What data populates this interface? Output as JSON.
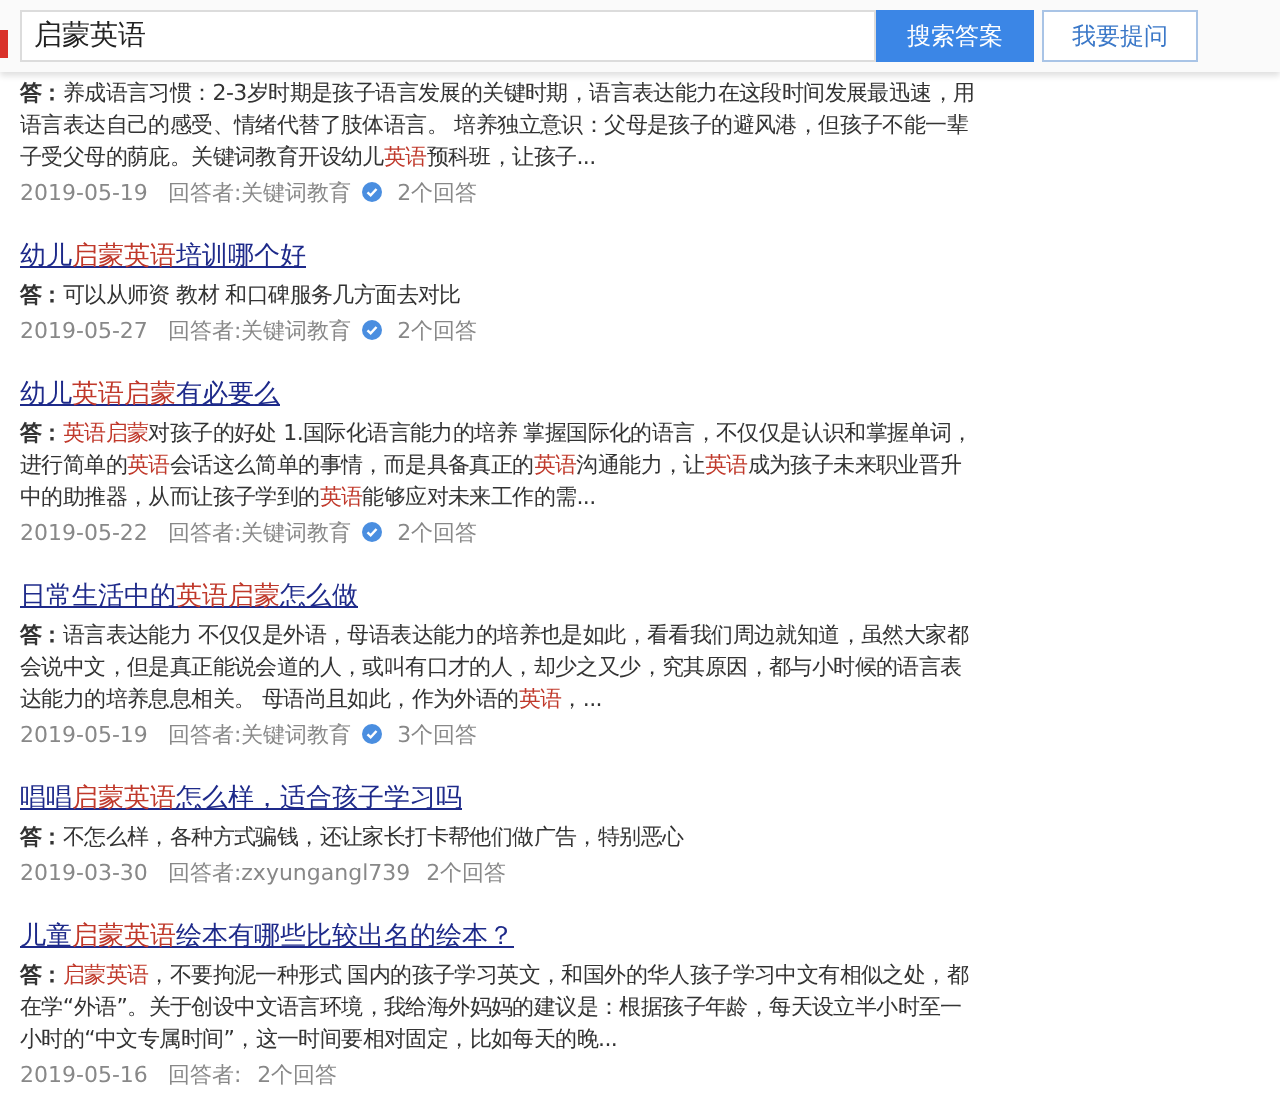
{
  "search": {
    "value": "启蒙英语",
    "submit": "搜索答案",
    "ask": "我要提问"
  },
  "results": [
    {
      "label": "答：",
      "answer": [
        {
          "text": "养成语言习惯：2-3岁时期是孩子语言发展的关键时期，语言表达能力在这段时间发展最迅速，用语言表达自己的感受、情绪代替了肢体语言。 培养独立意识：父母是孩子的避风港，但孩子不能一辈子受父母的荫庇。关键词教育开设幼儿",
          "highlight": false
        },
        {
          "text": "英语",
          "highlight": true
        },
        {
          "text": "预科班，让孩子...",
          "highlight": false
        }
      ],
      "date": "2019-05-19",
      "answerer_label": "回答者:",
      "answerer": "关键词教育",
      "verified": true,
      "count": "2个回答"
    },
    {
      "title": [
        {
          "text": "幼儿",
          "highlight": false
        },
        {
          "text": "启蒙英语",
          "highlight": true
        },
        {
          "text": "培训哪个好",
          "highlight": false
        }
      ],
      "label": "答：",
      "answer": [
        {
          "text": "可以从师资 教材 和口碑服务几方面去对比",
          "highlight": false
        }
      ],
      "date": "2019-05-27",
      "answerer_label": "回答者:",
      "answerer": "关键词教育",
      "verified": true,
      "count": "2个回答"
    },
    {
      "title": [
        {
          "text": "幼儿",
          "highlight": false
        },
        {
          "text": "英语启蒙",
          "highlight": true
        },
        {
          "text": "有必要么",
          "highlight": false
        }
      ],
      "label": "答：",
      "answer": [
        {
          "text": "英语启蒙",
          "highlight": true
        },
        {
          "text": "对孩子的好处 1.国际化语言能力的培养 掌握国际化的语言，不仅仅是认识和掌握单词，进行简单的",
          "highlight": false
        },
        {
          "text": "英语",
          "highlight": true
        },
        {
          "text": "会话这么简单的事情，而是具备真正的",
          "highlight": false
        },
        {
          "text": "英语",
          "highlight": true
        },
        {
          "text": "沟通能力，让",
          "highlight": false
        },
        {
          "text": "英语",
          "highlight": true
        },
        {
          "text": "成为孩子未来职业晋升中的助推器，从而让孩子学到的",
          "highlight": false
        },
        {
          "text": "英语",
          "highlight": true
        },
        {
          "text": "能够应对未来工作的需...",
          "highlight": false
        }
      ],
      "date": "2019-05-22",
      "answerer_label": "回答者:",
      "answerer": "关键词教育",
      "verified": true,
      "count": "2个回答"
    },
    {
      "title": [
        {
          "text": "日常生活中的",
          "highlight": false
        },
        {
          "text": "英语启蒙",
          "highlight": true
        },
        {
          "text": "怎么做",
          "highlight": false
        }
      ],
      "label": "答：",
      "answer": [
        {
          "text": "语言表达能力 不仅仅是外语，母语表达能力的培养也是如此，看看我们周边就知道，虽然大家都会说中文，但是真正能说会道的人，或叫有口才的人，却少之又少，究其原因，都与小时候的语言表达能力的培养息息相关。 母语尚且如此，作为外语的",
          "highlight": false
        },
        {
          "text": "英语",
          "highlight": true
        },
        {
          "text": "，...",
          "highlight": false
        }
      ],
      "date": "2019-05-19",
      "answerer_label": "回答者:",
      "answerer": "关键词教育",
      "verified": true,
      "count": "3个回答"
    },
    {
      "title": [
        {
          "text": "唱唱",
          "highlight": false
        },
        {
          "text": "启蒙英语",
          "highlight": true
        },
        {
          "text": "怎么样，适合孩子学习吗",
          "highlight": false
        }
      ],
      "label": "答：",
      "answer": [
        {
          "text": "不怎么样，各种方式骗钱，还让家长打卡帮他们做广告，特别恶心",
          "highlight": false
        }
      ],
      "date": "2019-03-30",
      "answerer_label": "回答者:",
      "answerer": "zxyungangl739",
      "verified": false,
      "count": "2个回答"
    },
    {
      "title": [
        {
          "text": "儿童",
          "highlight": false
        },
        {
          "text": "启蒙英语",
          "highlight": true
        },
        {
          "text": "绘本有哪些比较出名的绘本？",
          "highlight": false
        }
      ],
      "label": "答：",
      "answer": [
        {
          "text": "启蒙英语",
          "highlight": true
        },
        {
          "text": "，不要拘泥一种形式 国内的孩子学习英文，和国外的华人孩子学习中文有相似之处，都在学“外语”。关于创设中文语言环境，我给海外妈妈的建议是：根据孩子年龄，每天设立半小时至一小时的“中文专属时间”，这一时间要相对固定，比如每天的晚...",
          "highlight": false
        }
      ],
      "date": "2019-05-16",
      "answerer_label": "回答者:",
      "verified": false,
      "count": "2个回答"
    }
  ]
}
